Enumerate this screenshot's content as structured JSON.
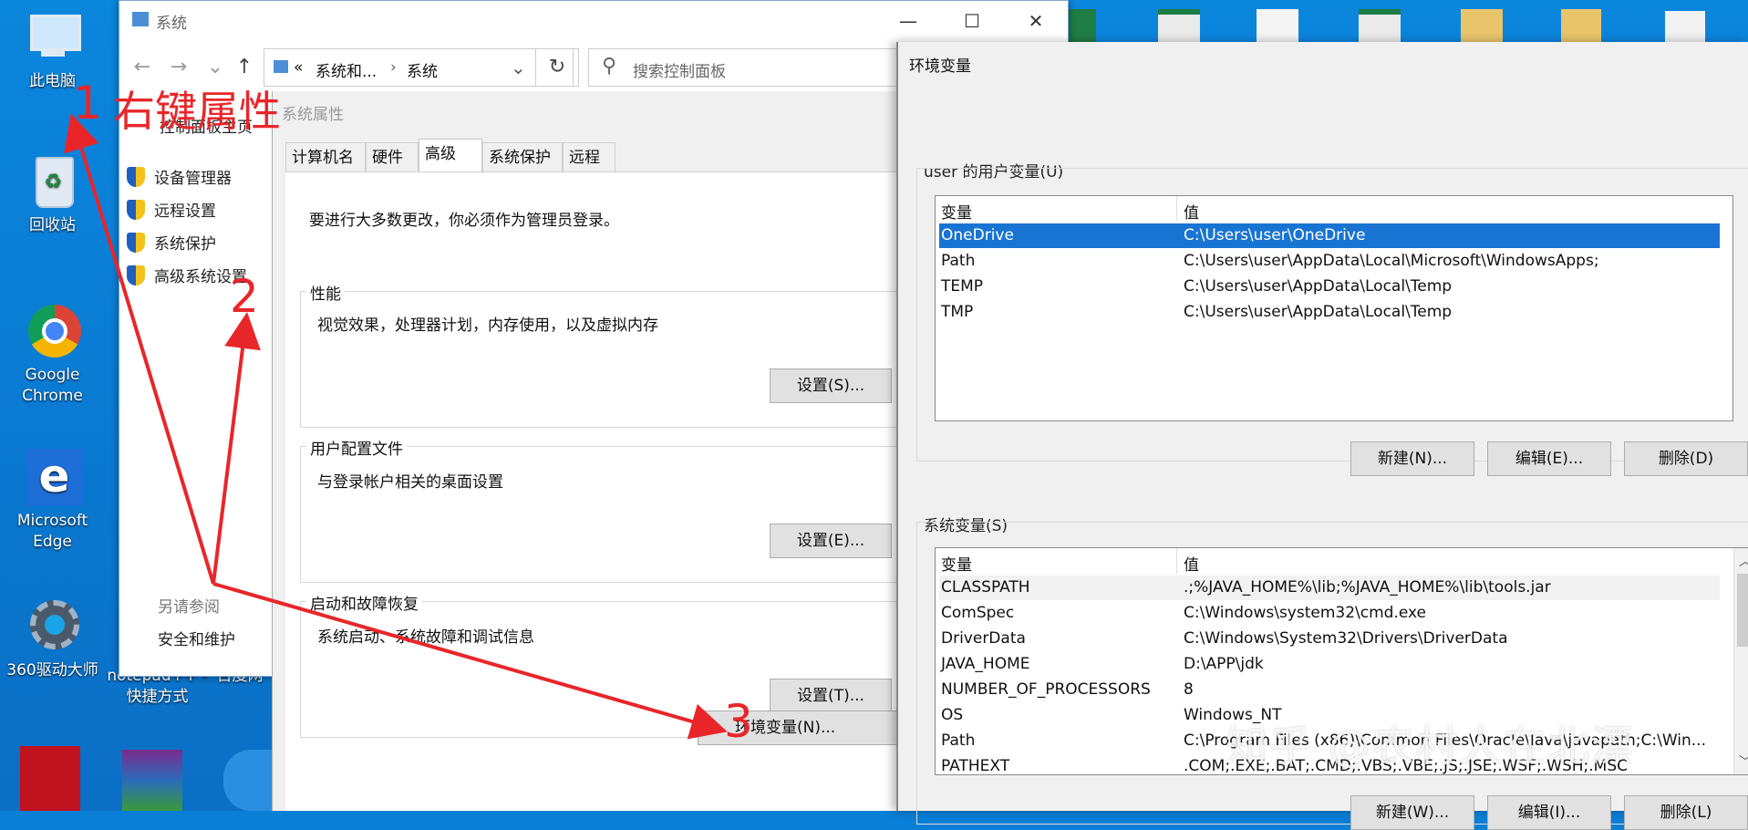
{
  "desktop": {
    "icons": [
      {
        "label": "此电脑"
      },
      {
        "label": "回收站"
      },
      {
        "label": "Google Chrome"
      },
      {
        "label": "Microsoft Edge"
      },
      {
        "label": "360驱动大师"
      },
      {
        "label": "notepad++ - 快捷方式"
      },
      {
        "label": "百度网"
      }
    ]
  },
  "explorer": {
    "title": "系统",
    "address": {
      "crumb1": "系统和...",
      "crumb2": "系统",
      "sep": "«",
      "arrow": "›"
    },
    "search_placeholder": "搜索控制面板",
    "left_nav": {
      "home": "控制面板主页",
      "links": [
        "设备管理器",
        "远程设置",
        "系统保护",
        "高级系统设置"
      ],
      "see_also": "另请参阅",
      "security": "安全和维护"
    }
  },
  "system_properties": {
    "title": "系统属性",
    "tabs": [
      "计算机名",
      "硬件",
      "高级",
      "系统保护",
      "远程"
    ],
    "selected_tab": "高级",
    "admin_note": "要进行大多数更改，你必须作为管理员登录。",
    "performance": {
      "label": "性能",
      "desc": "视觉效果，处理器计划，内存使用，以及虚拟内存",
      "button": "设置(S)..."
    },
    "user_profiles": {
      "label": "用户配置文件",
      "desc": "与登录帐户相关的桌面设置",
      "button": "设置(E)..."
    },
    "startup": {
      "label": "启动和故障恢复",
      "desc": "系统启动、系统故障和调试信息",
      "button": "设置(T)..."
    },
    "env_button": "环境变量(N)..."
  },
  "env_vars": {
    "title": "环境变量",
    "user_section": "user 的用户变量(U)",
    "col_var": "变量",
    "col_val": "值",
    "user_vars": [
      {
        "name": "OneDrive",
        "value": "C:\\Users\\user\\OneDrive"
      },
      {
        "name": "Path",
        "value": "C:\\Users\\user\\AppData\\Local\\Microsoft\\WindowsApps;"
      },
      {
        "name": "TEMP",
        "value": "C:\\Users\\user\\AppData\\Local\\Temp"
      },
      {
        "name": "TMP",
        "value": "C:\\Users\\user\\AppData\\Local\\Temp"
      }
    ],
    "user_buttons": {
      "new": "新建(N)...",
      "edit": "编辑(E)...",
      "delete": "删除(D)"
    },
    "system_section": "系统变量(S)",
    "system_vars": [
      {
        "name": "CLASSPATH",
        "value": ".;%JAVA_HOME%\\lib;%JAVA_HOME%\\lib\\tools.jar"
      },
      {
        "name": "ComSpec",
        "value": "C:\\Windows\\system32\\cmd.exe"
      },
      {
        "name": "DriverData",
        "value": "C:\\Windows\\System32\\Drivers\\DriverData"
      },
      {
        "name": "JAVA_HOME",
        "value": "D:\\APP\\jdk"
      },
      {
        "name": "NUMBER_OF_PROCESSORS",
        "value": "8"
      },
      {
        "name": "OS",
        "value": "Windows_NT"
      },
      {
        "name": "Path",
        "value": "C:\\Program Files (x86)\\Common Files\\Oracle\\Java\\javapath;C:\\Win..."
      },
      {
        "name": "PATHEXT",
        "value": ".COM;.EXE;.BAT;.CMD;.VBS;.VBE;.JS;.JSE;.WSF;.WSH;.MSC"
      }
    ],
    "system_buttons": {
      "new": "新建(W)...",
      "edit": "编辑(I)...",
      "delete": "删除(L)"
    }
  },
  "annotations": {
    "step1": "1",
    "step1_text": "右键属性",
    "step2": "2",
    "step3": "3",
    "color": "#e8262a"
  },
  "watermark": "知乎 @农村人在北漂"
}
